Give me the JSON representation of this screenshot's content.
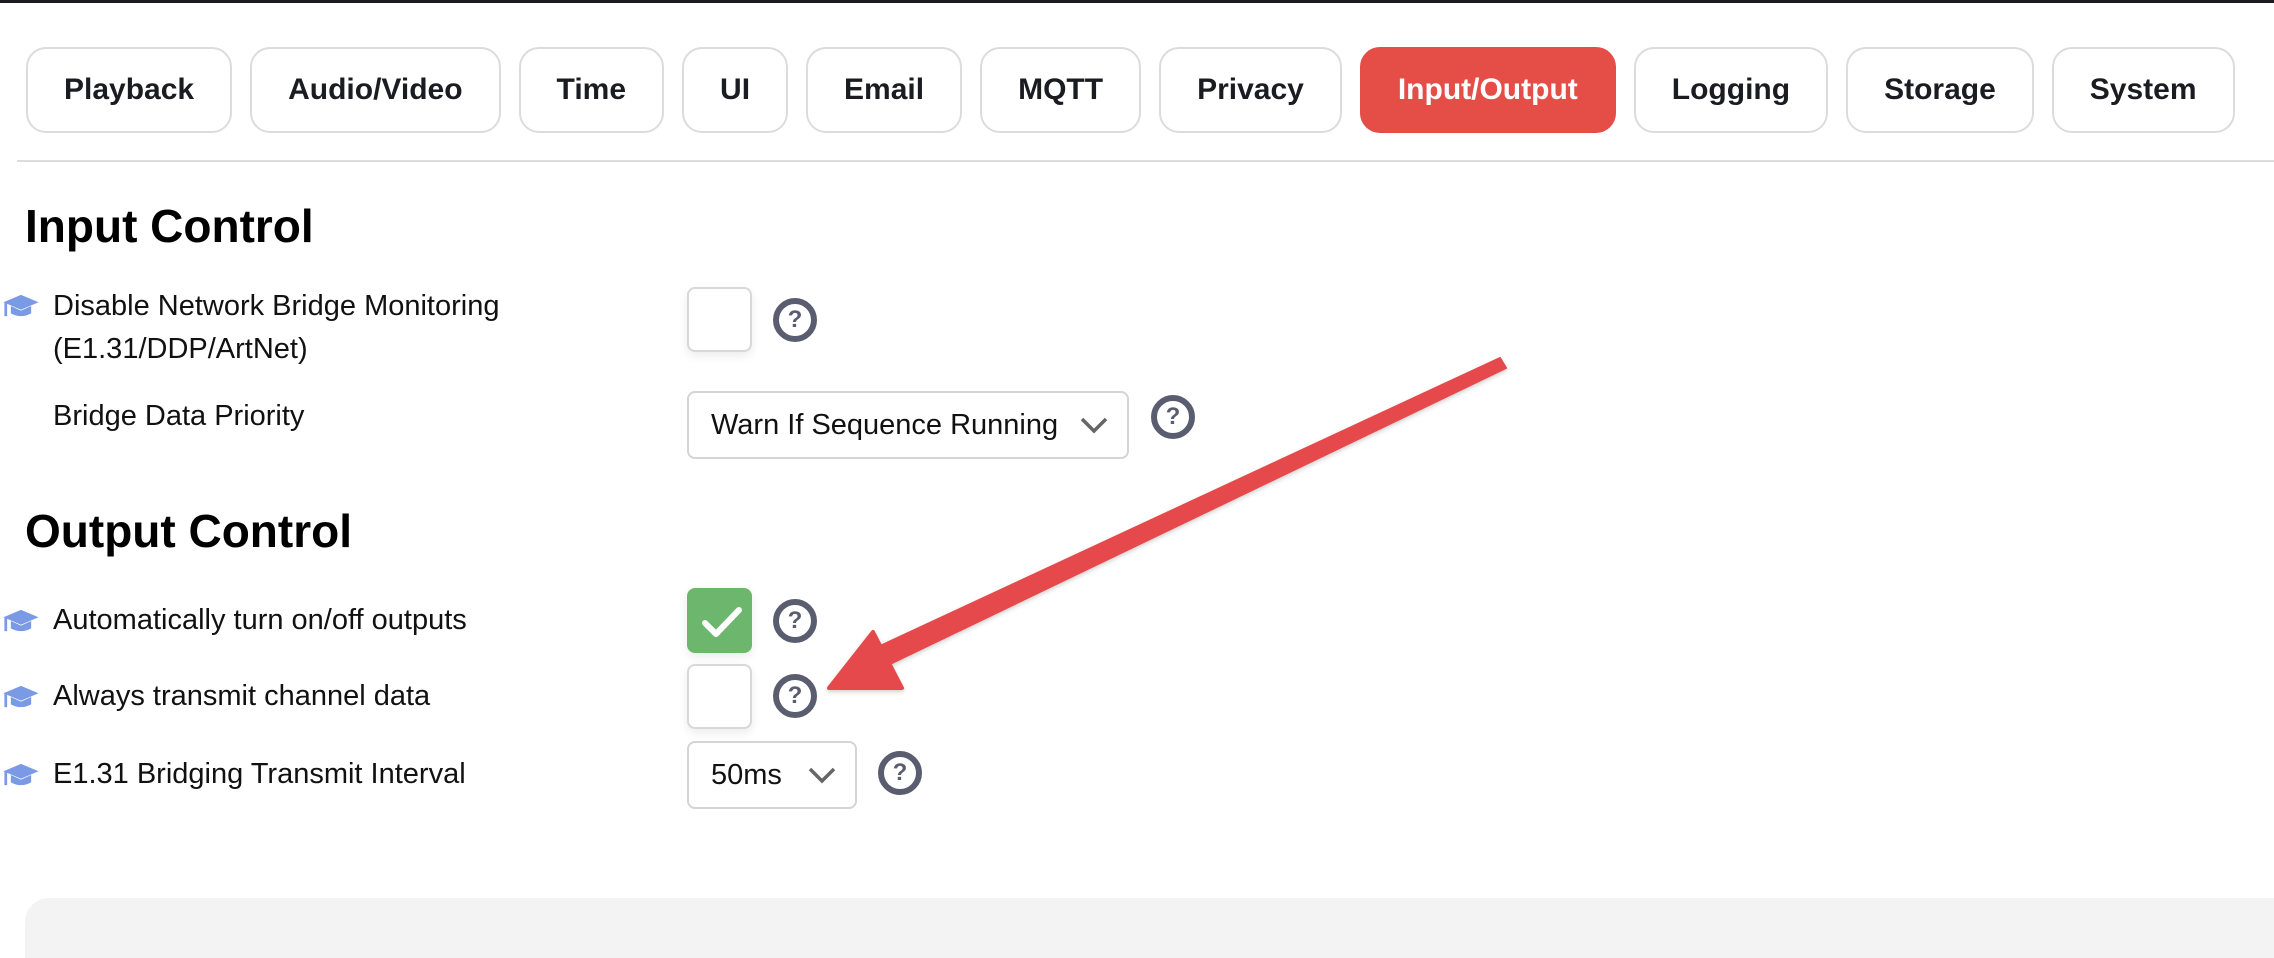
{
  "tabs": [
    {
      "label": "Playback",
      "active": false
    },
    {
      "label": "Audio/Video",
      "active": false
    },
    {
      "label": "Time",
      "active": false
    },
    {
      "label": "UI",
      "active": false
    },
    {
      "label": "Email",
      "active": false
    },
    {
      "label": "MQTT",
      "active": false
    },
    {
      "label": "Privacy",
      "active": false
    },
    {
      "label": "Input/Output",
      "active": true
    },
    {
      "label": "Logging",
      "active": false
    },
    {
      "label": "Storage",
      "active": false
    },
    {
      "label": "System",
      "active": false
    }
  ],
  "colors": {
    "active_tab": "#e54d47",
    "checked": "#6db66d",
    "help_icon": "#5a5d70",
    "cap_icon": "#7b9ae6",
    "annotation_arrow": "#e54a4c"
  },
  "input_control": {
    "heading": "Input Control",
    "disable_bridge_monitoring": {
      "label_line1": "Disable Network Bridge Monitoring",
      "label_line2": "(E1.31/DDP/ArtNet)",
      "checked": false,
      "help": "?"
    },
    "bridge_data_priority": {
      "label": "Bridge Data Priority",
      "value": "Warn If Sequence Running",
      "help": "?"
    }
  },
  "output_control": {
    "heading": "Output Control",
    "auto_outputs": {
      "label": "Automatically turn on/off outputs",
      "checked": true,
      "help": "?"
    },
    "always_transmit": {
      "label": "Always transmit channel data",
      "checked": false,
      "help": "?"
    },
    "transmit_interval": {
      "label": "E1.31 Bridging Transmit Interval",
      "value": "50ms",
      "help": "?"
    }
  }
}
